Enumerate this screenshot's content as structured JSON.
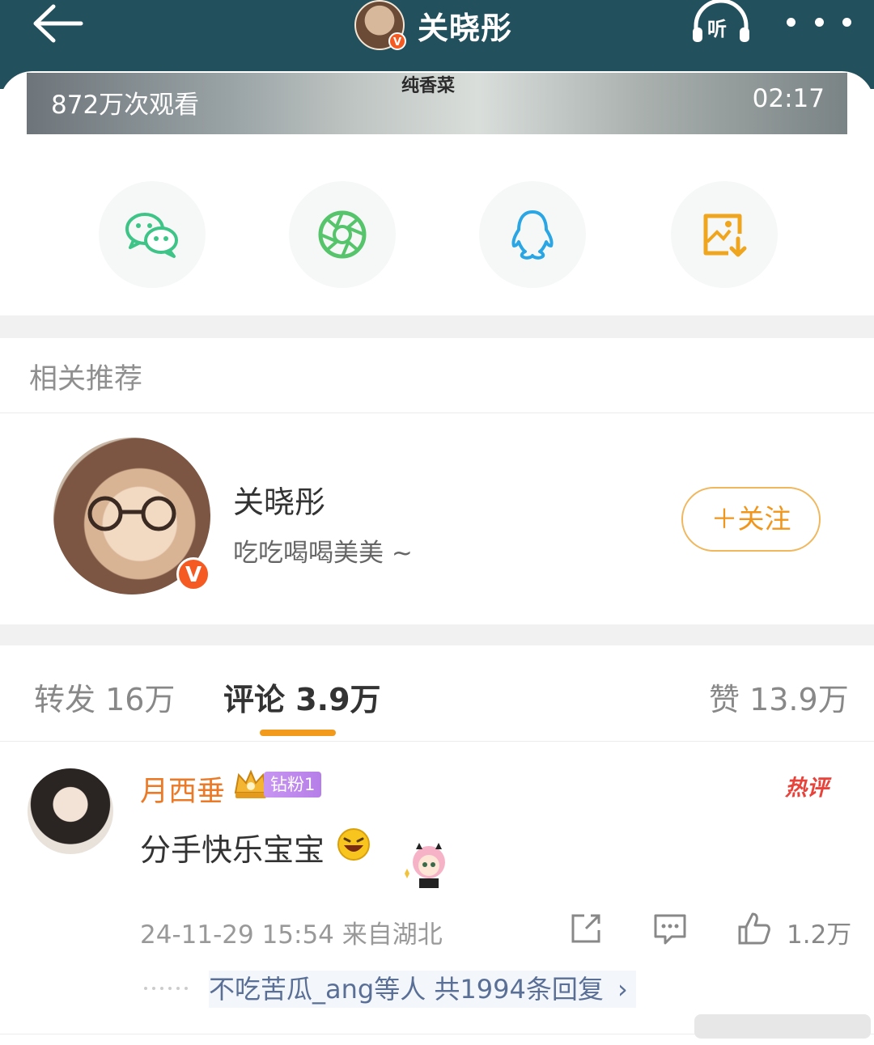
{
  "header": {
    "user_name": "关晓彤",
    "listen_label": "听",
    "avatar_badge": "V"
  },
  "video": {
    "views": "872万次观看",
    "duration": "02:17",
    "subtitle": "纯香菜"
  },
  "share": {
    "items": [
      {
        "icon": "wechat-icon",
        "color": "#3fc488"
      },
      {
        "icon": "moments-icon",
        "color": "#55c46a"
      },
      {
        "icon": "qq-icon",
        "color": "#2aa6e4"
      },
      {
        "icon": "save-image-icon",
        "color": "#f0a51e"
      }
    ]
  },
  "related": {
    "title": "相关推荐",
    "user": {
      "name": "关晓彤",
      "bio": "吃吃喝喝美美 ~",
      "badge": "V",
      "follow_label": "＋关注"
    }
  },
  "tabs": [
    {
      "label": "转发 16万",
      "active": false
    },
    {
      "label": "评论 3.9万",
      "active": true
    },
    {
      "label": "赞 13.9万",
      "active": false
    }
  ],
  "comment": {
    "user": "月西垂",
    "fan_badge": "钻粉1",
    "hot_label": "热评",
    "text": "分手快乐宝宝",
    "meta": "24-11-29 15:54  来自湖北",
    "like_count": "1.2万",
    "reply_summary": "不吃苦瓜_ang等人  共1994条回复",
    "reply_chevron": "›"
  },
  "colors": {
    "header_bg": "#23505d",
    "accent_orange": "#f29a1c",
    "username_orange": "#eb7a28",
    "hot_red": "#e8433b",
    "reply_blue": "#5a6f96"
  }
}
